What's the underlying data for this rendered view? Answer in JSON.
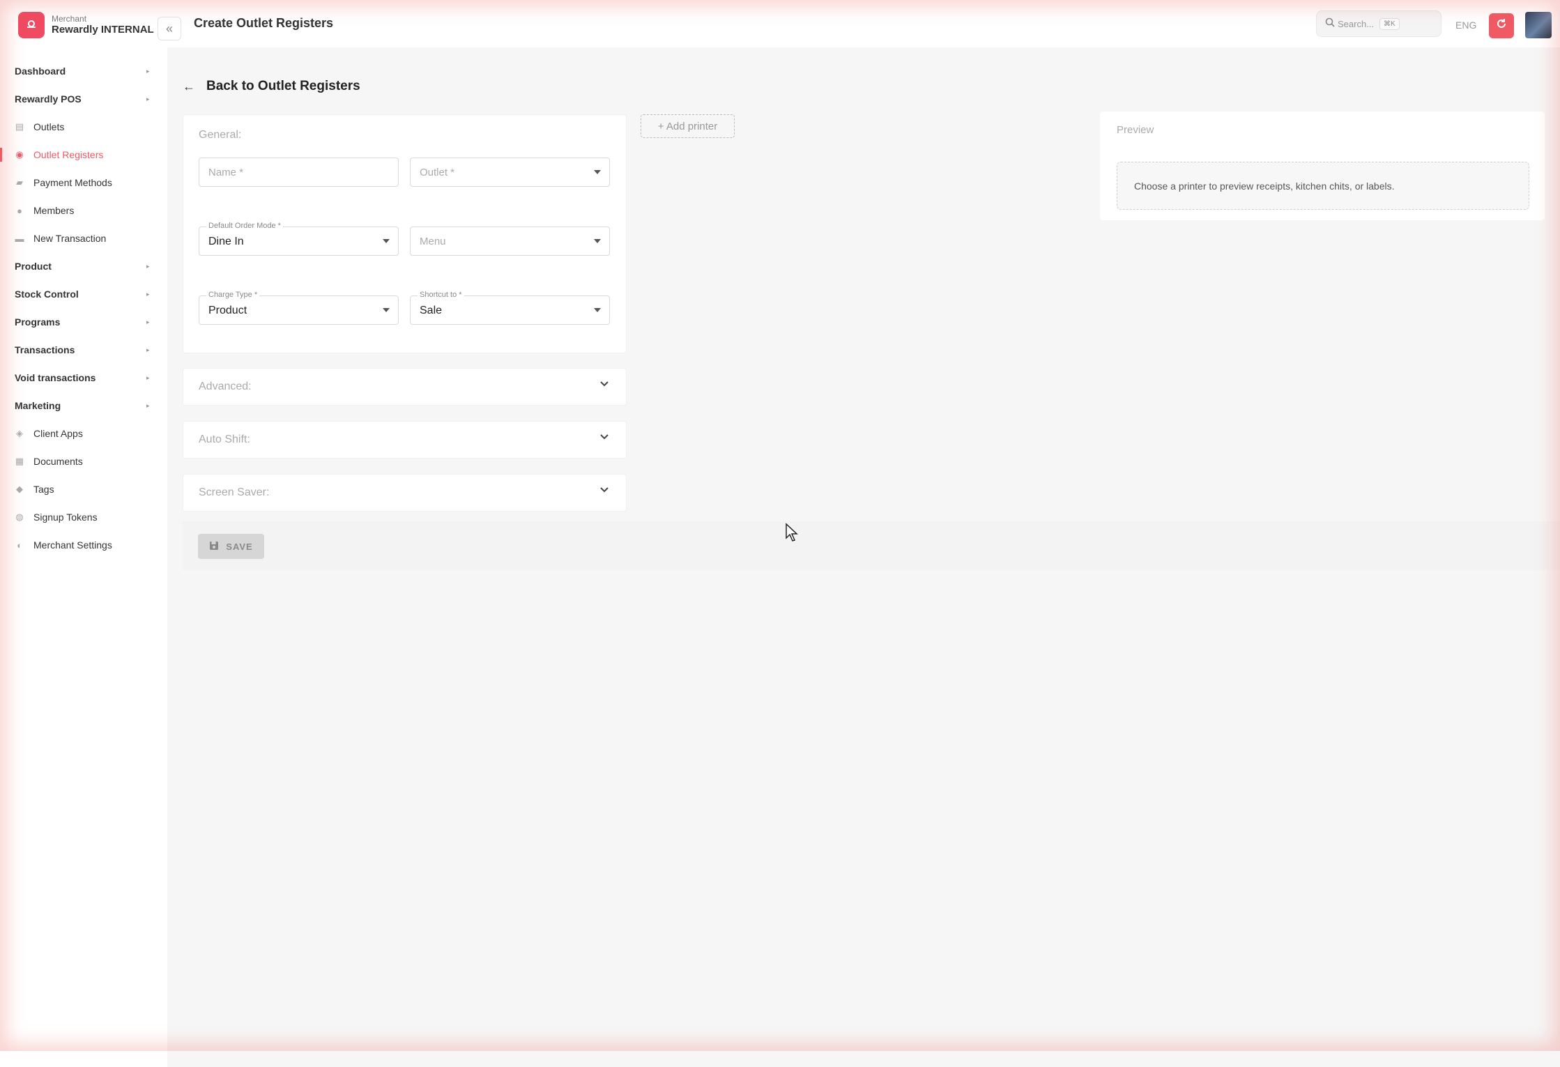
{
  "brand": {
    "subtitle": "Merchant",
    "name": "Rewardly INTERNAL",
    "logo_icon": "bag-icon"
  },
  "sidebar": {
    "items": [
      {
        "label": "Dashboard",
        "type": "group"
      },
      {
        "label": "Rewardly POS",
        "type": "group"
      },
      {
        "label": "Outlets",
        "type": "sub",
        "icon": "store-icon",
        "glyph": "▤"
      },
      {
        "label": "Outlet Registers",
        "type": "sub",
        "icon": "register-icon",
        "glyph": "◉",
        "active": true
      },
      {
        "label": "Payment Methods",
        "type": "sub",
        "icon": "payment-icon",
        "glyph": "▰"
      },
      {
        "label": "Members",
        "type": "sub",
        "icon": "members-icon",
        "glyph": "●"
      },
      {
        "label": "New Transaction",
        "type": "sub",
        "icon": "card-icon",
        "glyph": "▬"
      },
      {
        "label": "Product",
        "type": "group"
      },
      {
        "label": "Stock Control",
        "type": "group"
      },
      {
        "label": "Programs",
        "type": "group"
      },
      {
        "label": "Transactions",
        "type": "group"
      },
      {
        "label": "Void transactions",
        "type": "group"
      },
      {
        "label": "Marketing",
        "type": "group"
      },
      {
        "label": "Client Apps",
        "type": "sub",
        "icon": "code-icon",
        "glyph": "◈"
      },
      {
        "label": "Documents",
        "type": "sub",
        "icon": "document-icon",
        "glyph": "▦"
      },
      {
        "label": "Tags",
        "type": "sub",
        "icon": "tag-icon",
        "glyph": "◆"
      },
      {
        "label": "Signup Tokens",
        "type": "sub",
        "icon": "token-icon",
        "glyph": "◍"
      },
      {
        "label": "Merchant Settings",
        "type": "sub",
        "icon": "settings-icon",
        "glyph": "◐"
      }
    ]
  },
  "header": {
    "title": "Create Outlet Registers",
    "search_placeholder": "Search...",
    "search_shortcut": "⌘K",
    "language": "ENG"
  },
  "main": {
    "back_label": "Back to Outlet Registers",
    "general": {
      "title": "General:",
      "name_placeholder": "Name *",
      "outlet_placeholder": "Outlet *",
      "order_mode_label": "Default Order Mode *",
      "order_mode_value": "Dine In",
      "menu_placeholder": "Menu",
      "charge_type_label": "Charge Type *",
      "charge_type_value": "Product",
      "shortcut_label": "Shortcut to *",
      "shortcut_value": "Sale"
    },
    "sections": {
      "advanced": "Advanced:",
      "auto_shift": "Auto Shift:",
      "screen_saver": "Screen Saver:"
    },
    "save_label": "SAVE",
    "add_printer_label": "+ Add printer",
    "preview": {
      "title": "Preview",
      "message": "Choose a printer to preview receipts, kitchen chits, or labels."
    }
  },
  "colors": {
    "accent": "#ef5a64",
    "brand": "#ef4b63"
  }
}
